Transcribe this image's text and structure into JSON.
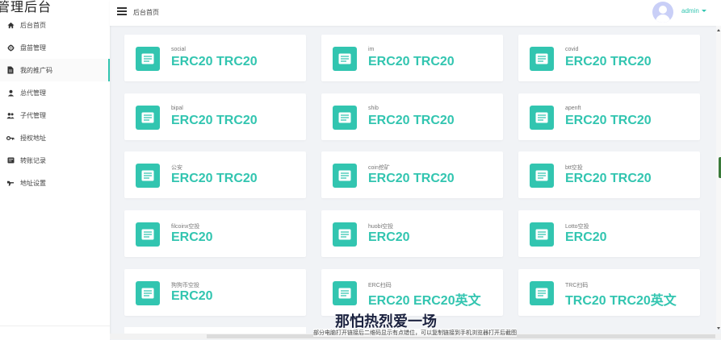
{
  "app": {
    "brand": "管理后台"
  },
  "sidebar": {
    "items": [
      {
        "label": "后台首页",
        "icon": "home-icon",
        "active": false
      },
      {
        "label": "盘苗管理",
        "icon": "gear-icon",
        "active": false
      },
      {
        "label": "我的推广码",
        "icon": "file-icon",
        "active": true
      },
      {
        "label": "总代管理",
        "icon": "user-icon",
        "active": false
      },
      {
        "label": "子代管理",
        "icon": "users-icon",
        "active": false
      },
      {
        "label": "授权地址",
        "icon": "key-icon",
        "active": false
      },
      {
        "label": "转账记录",
        "icon": "list-icon",
        "active": false
      },
      {
        "label": "地址设置",
        "icon": "tool-icon",
        "active": false
      }
    ]
  },
  "header": {
    "breadcrumb": "后台首页",
    "user": "admin"
  },
  "cards": [
    {
      "name": "social",
      "value": "ERC20 TRC20"
    },
    {
      "name": "im",
      "value": "ERC20 TRC20"
    },
    {
      "name": "covid",
      "value": "ERC20 TRC20"
    },
    {
      "name": "bipal",
      "value": "ERC20 TRC20"
    },
    {
      "name": "shib",
      "value": "ERC20 TRC20"
    },
    {
      "name": "apenft",
      "value": "ERC20 TRC20"
    },
    {
      "name": "公安",
      "value": "ERC20 TRC20"
    },
    {
      "name": "coin挖矿",
      "value": "ERC20 TRC20"
    },
    {
      "name": "btt空投",
      "value": "ERC20 TRC20"
    },
    {
      "name": "filcoinx空投",
      "value": "ERC20"
    },
    {
      "name": "huobi空投",
      "value": "ERC20"
    },
    {
      "name": "Lotto空投",
      "value": "ERC20"
    },
    {
      "name": "狗狗币空投",
      "value": "ERC20"
    },
    {
      "name": "ERC扫码",
      "value": "ERC20 ERC20英文"
    },
    {
      "name": "TRC扫码",
      "value": "TRC20 TRC20英文"
    }
  ],
  "overlay": {
    "subtitle": "那怕热烈爱一场",
    "caption": "部分电脑打开链接后二维码显示有点错位，可以复制链接到手机浏览器打开后截图"
  },
  "colors": {
    "accent": "#32c5b0",
    "background": "#f1f3f6"
  }
}
